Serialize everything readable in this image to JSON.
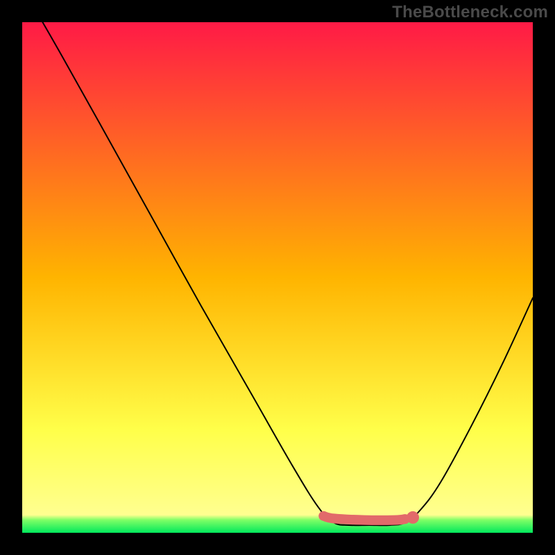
{
  "watermark": "TheBottleneck.com",
  "chart_data": {
    "type": "line",
    "title": "",
    "xlabel": "",
    "ylabel": "",
    "xlim": [
      0,
      100
    ],
    "ylim": [
      0,
      100
    ],
    "grid": false,
    "background_gradient": {
      "stops": [
        {
          "offset": 0.0,
          "color": "#ff1a46"
        },
        {
          "offset": 0.5,
          "color": "#ffb400"
        },
        {
          "offset": 0.8,
          "color": "#ffff4a"
        },
        {
          "offset": 0.965,
          "color": "#ffff90"
        },
        {
          "offset": 0.975,
          "color": "#7eff66"
        },
        {
          "offset": 1.0,
          "color": "#00e85c"
        }
      ]
    },
    "series": [
      {
        "name": "bottleneck-curve",
        "color": "#000000",
        "width": 2,
        "points": [
          {
            "x": 4.0,
            "y": 100.0
          },
          {
            "x": 8.0,
            "y": 93.0
          },
          {
            "x": 15.0,
            "y": 80.5
          },
          {
            "x": 25.0,
            "y": 62.5
          },
          {
            "x": 35.0,
            "y": 44.5
          },
          {
            "x": 45.0,
            "y": 27.0
          },
          {
            "x": 53.0,
            "y": 13.0
          },
          {
            "x": 58.0,
            "y": 5.0
          },
          {
            "x": 61.0,
            "y": 2.0
          },
          {
            "x": 64.0,
            "y": 1.5
          },
          {
            "x": 68.0,
            "y": 1.5
          },
          {
            "x": 72.0,
            "y": 1.5
          },
          {
            "x": 75.0,
            "y": 2.0
          },
          {
            "x": 78.0,
            "y": 4.5
          },
          {
            "x": 82.0,
            "y": 10.0
          },
          {
            "x": 88.0,
            "y": 21.0
          },
          {
            "x": 94.0,
            "y": 33.0
          },
          {
            "x": 100.0,
            "y": 46.0
          }
        ]
      }
    ],
    "markers": [
      {
        "name": "optimal-range",
        "color": "#e26a6a",
        "style": "thick-band-with-end-dots",
        "points": [
          {
            "x": 59.0,
            "y": 3.3
          },
          {
            "x": 61.0,
            "y": 2.8
          },
          {
            "x": 67.0,
            "y": 2.5
          },
          {
            "x": 73.0,
            "y": 2.5
          },
          {
            "x": 75.0,
            "y": 2.7
          }
        ],
        "end_dot": {
          "x": 76.5,
          "y": 3.0
        },
        "band_width": 14,
        "dot_radius": 9
      }
    ]
  }
}
